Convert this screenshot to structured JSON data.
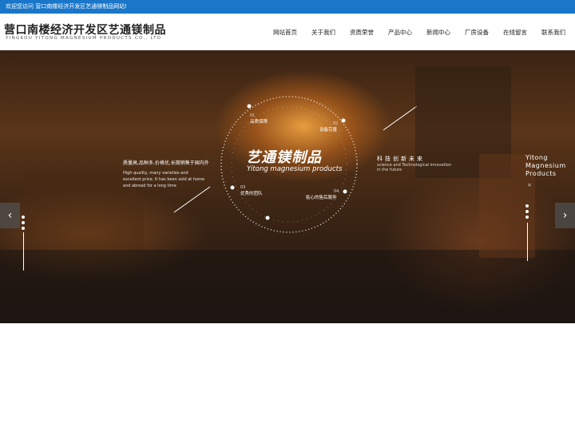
{
  "topbar": {
    "welcome": "欢迎您访问 营口南楼经济开发区艺通镁制品网站!"
  },
  "header": {
    "logo_cn": "营口南楼经济开发区艺通镁制品",
    "logo_en": "YINGKOU YITONG MAGNESIUM PRODUCTS CO., LTD"
  },
  "nav": {
    "items": [
      "网站首页",
      "关于我们",
      "资质荣誉",
      "产品中心",
      "新闻中心",
      "厂房设备",
      "在线留言",
      "联系我们"
    ]
  },
  "banner": {
    "title_cn": "艺通镁制品",
    "title_en": "Yitong magnesium products",
    "points": [
      {
        "num": "01",
        "label": "品质保障"
      },
      {
        "num": "02",
        "label": "设备完善"
      },
      {
        "num": "03",
        "label": "优秀的团队"
      },
      {
        "num": "04",
        "label": "贴心的售后服务"
      }
    ],
    "left_heading": "质量高,品种多,价格优,长期销售于国内外",
    "left_text": "High quality, many varieties and excellent price. It has been sold at home and abroad for a long time",
    "tech_cn": "科技创新未来",
    "tech_en": "science and Technological innovation in the future",
    "brand_lines": [
      "Yitong",
      "Magnesium",
      "Products"
    ],
    "brand_x": "×",
    "prev_label": "‹",
    "next_label": "›"
  },
  "colors": {
    "topbar": "#1976c8",
    "accent_glow": "#ffaf46"
  }
}
